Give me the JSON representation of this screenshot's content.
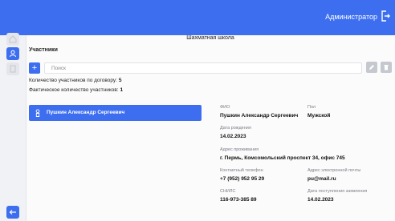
{
  "header": {
    "user_label": "Администратор"
  },
  "page_title": "Шахматная школа",
  "section_title": "Участники",
  "search": {
    "placeholder": "Поиск",
    "value": ""
  },
  "counts": {
    "contract_label": "Количество участников по договору:",
    "contract_value": "5",
    "actual_label": "Фактическое количество участников:",
    "actual_value": "1"
  },
  "participants": [
    {
      "name": "Пушкин Александр Сергеевич"
    }
  ],
  "details": {
    "fio_label": "ФИО",
    "fio_value": "Пушкин Александр Сергеевич",
    "gender_label": "Пол",
    "gender_value": "Мужской",
    "birth_label": "Дата рождения",
    "birth_value": "14.02.2023",
    "address_label": "Адрес проживания",
    "address_value": "г. Пермь, Комсомольский проспект 34, офис 745",
    "phone_label": "Контактный телефон",
    "phone_value": "+7 (952) 952 95 29",
    "email_label": "Адрес электронной почты",
    "email_value": "pu@mail.ru",
    "snils_label": "СНИЛС",
    "snils_value": "116-973-385 89",
    "application_label": "Дата поступления заявления",
    "application_value": "14.02.2023"
  },
  "colors": {
    "accent": "#3d6ef0",
    "sidebar": "#f1f2f5",
    "disabled_btn": "#c5c8ce"
  },
  "icons": {
    "logout": "logout-icon",
    "nav_1": "home-icon",
    "nav_2": "users-icon",
    "nav_3": "document-icon",
    "back": "arrow-left-icon",
    "add": "plus-icon",
    "edit": "edit-icon",
    "delete": "trash-icon",
    "person": "person-icon"
  }
}
